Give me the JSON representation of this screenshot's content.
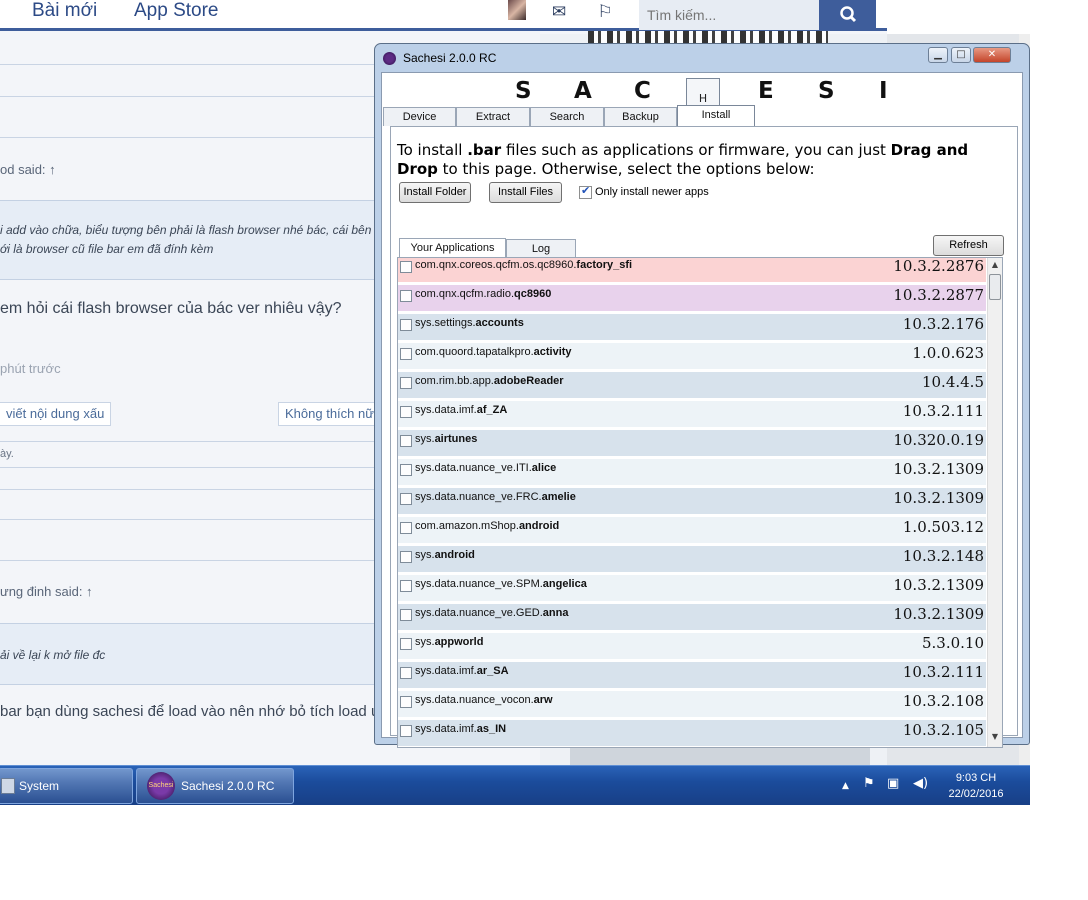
{
  "web": {
    "nav": {
      "new_posts": "Bài mới",
      "app_store": "App Store"
    },
    "search_placeholder": "Tìm kiếm...",
    "forum": {
      "said1": "od said: ↑",
      "quote1_line1": "i add vào chữa, biểu tượng bên phải là flash browser nhé bác, cái bên",
      "quote1_line2": "ới là browser cũ file bar em đã đính kèm",
      "post1": "em hỏi cái flash browser của bác ver nhiêu vậy?",
      "time1": "phút trước",
      "btn_report": "viết nội dung xấu",
      "btn_dislike": "Không thích nữ",
      "small1": "ày.",
      "said2": "ưng đinh said: ↑",
      "quote2": "ải về lại k mở file đc",
      "post2": "bar bạn dùng sachesi để load vào nên nhớ bỏ tích load ứng"
    }
  },
  "window": {
    "title": "Sachesi 2.0.0 RC",
    "logo": [
      "S",
      "A",
      "C",
      "H",
      "E",
      "S",
      "I"
    ],
    "tabs": [
      "Device",
      "Extract",
      "Search",
      "Backup",
      "Install"
    ],
    "active_tab": "Install",
    "instructions": {
      "p1": "To install ",
      "b1": ".bar",
      "p2": " files such as applications or firmware, you can just ",
      "b2": "Drag and Drop",
      "p3": " to this page. Otherwise, select the options below:"
    },
    "buttons": {
      "install_folder": "Install Folder",
      "install_files": "Install Files",
      "refresh": "Refresh"
    },
    "only_newer": {
      "label": "Only install newer apps",
      "checked": true
    },
    "subtabs": [
      "Your Applications",
      "Log"
    ],
    "apps": [
      {
        "prefix": "com.qnx.coreos.qcfm.os.qc8960.",
        "name": "factory_sfi",
        "version": "10.3.2.2876",
        "color": "#fbd3d3"
      },
      {
        "prefix": "com.qnx.qcfm.radio.",
        "name": "qc8960",
        "version": "10.3.2.2877",
        "color": "#e8d2ec"
      },
      {
        "prefix": "sys.settings.",
        "name": "accounts",
        "version": "10.3.2.176",
        "color": "#d7e2ec"
      },
      {
        "prefix": "com.quoord.tapatalkpro.",
        "name": "activity",
        "version": "1.0.0.623",
        "color": "#edf3f7"
      },
      {
        "prefix": "com.rim.bb.app.",
        "name": "adobeReader",
        "version": "10.4.4.5",
        "color": "#d7e2ec"
      },
      {
        "prefix": "sys.data.imf.",
        "name": "af_ZA",
        "version": "10.3.2.111",
        "color": "#edf3f7"
      },
      {
        "prefix": "sys.",
        "name": "airtunes",
        "version": "10.320.0.19",
        "color": "#d7e2ec"
      },
      {
        "prefix": "sys.data.nuance_ve.ITI.",
        "name": "alice",
        "version": "10.3.2.1309",
        "color": "#edf3f7"
      },
      {
        "prefix": "sys.data.nuance_ve.FRC.",
        "name": "amelie",
        "version": "10.3.2.1309",
        "color": "#d7e2ec"
      },
      {
        "prefix": "com.amazon.mShop.",
        "name": "android",
        "version": "1.0.503.12",
        "color": "#edf3f7"
      },
      {
        "prefix": "sys.",
        "name": "android",
        "version": "10.3.2.148",
        "color": "#d7e2ec"
      },
      {
        "prefix": "sys.data.nuance_ve.SPM.",
        "name": "angelica",
        "version": "10.3.2.1309",
        "color": "#edf3f7"
      },
      {
        "prefix": "sys.data.nuance_ve.GED.",
        "name": "anna",
        "version": "10.3.2.1309",
        "color": "#d7e2ec"
      },
      {
        "prefix": "sys.",
        "name": "appworld",
        "version": "5.3.0.10",
        "color": "#edf3f7"
      },
      {
        "prefix": "sys.data.imf.",
        "name": "ar_SA",
        "version": "10.3.2.111",
        "color": "#d7e2ec"
      },
      {
        "prefix": "sys.data.nuance_vocon.",
        "name": "arw",
        "version": "10.3.2.108",
        "color": "#edf3f7"
      },
      {
        "prefix": "sys.data.imf.",
        "name": "as_IN",
        "version": "10.3.2.105",
        "color": "#d7e2ec"
      }
    ]
  },
  "taskbar": {
    "system_label": "System",
    "sachesi_label": "Sachesi 2.0.0 RC",
    "sachesi_icon_text": "Sachesi",
    "time": "9:03 CH",
    "date": "22/02/2016"
  }
}
